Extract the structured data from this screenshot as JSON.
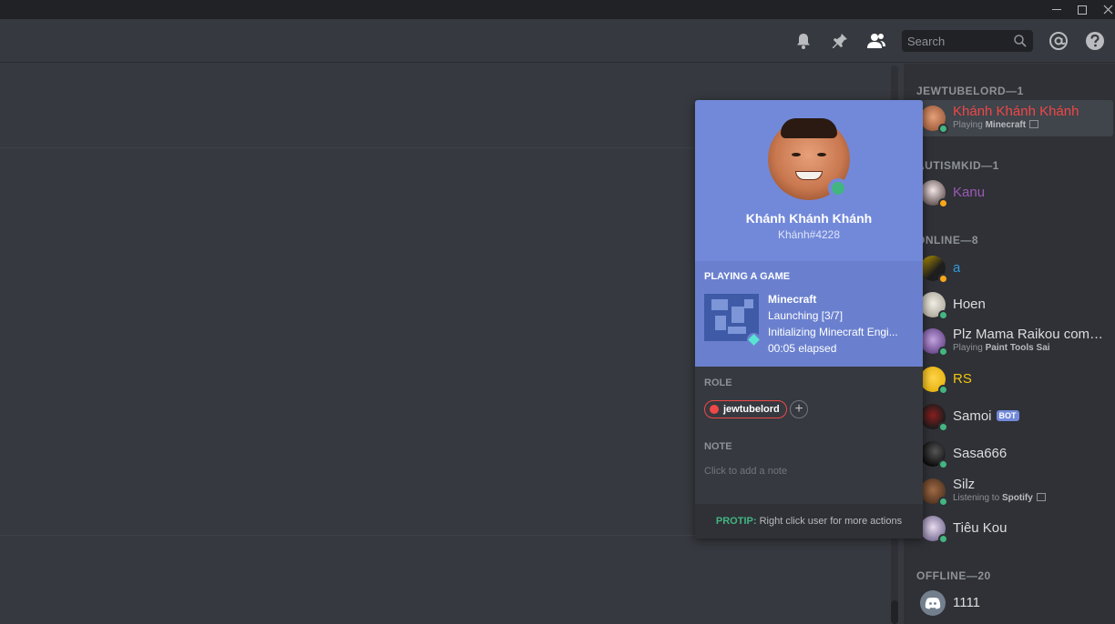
{
  "titlebar": {
    "controls": [
      "minimize",
      "maximize",
      "close"
    ]
  },
  "header": {
    "icons": [
      "bell-icon",
      "pin-icon",
      "members-icon",
      "at-mention-icon",
      "help-icon"
    ],
    "search_placeholder": "Search"
  },
  "popout": {
    "display_name": "Khánh Khánh Khánh",
    "tag": "Khánh#4228",
    "status": "online",
    "activity": {
      "heading": "PLAYING A GAME",
      "game": "Minecraft",
      "details": "Launching [3/7]",
      "state": "Initializing Minecraft Engi...",
      "elapsed": "00:05 elapsed"
    },
    "role_heading": "ROLE",
    "role": {
      "name": "jewtubelord",
      "color": "#f04747"
    },
    "note_heading": "NOTE",
    "note_placeholder": "Click to add a note",
    "protip_label": "PROTIP:",
    "protip_text": "Right click user for more actions"
  },
  "members": {
    "groups": [
      {
        "title": "JEWTUBELORD—1",
        "members": [
          {
            "name": "Khánh Khánh Khánh",
            "color": "#f04747",
            "status": "online",
            "sub_prefix": "Playing",
            "sub_bold": "Minecraft",
            "rich": true,
            "active": true
          }
        ]
      },
      {
        "title": "AUTISMKID—1",
        "members": [
          {
            "name": "Kanu",
            "color": "#9b59b6",
            "status": "idle"
          }
        ]
      },
      {
        "title": "ONLINE—8",
        "members": [
          {
            "name": "a",
            "color": "#3498db",
            "status": "idle"
          },
          {
            "name": "Hoen",
            "color": "#dcddde",
            "status": "online"
          },
          {
            "name": "Plz Mama Raikou come...",
            "color": "#dcddde",
            "status": "online",
            "sub_prefix": "Playing",
            "sub_bold": "Paint Tools Sai"
          },
          {
            "name": "RS",
            "color": "#f1c40f",
            "status": "online"
          },
          {
            "name": "Samoi",
            "color": "#dcddde",
            "status": "online",
            "bot": "BOT"
          },
          {
            "name": "Sasa666",
            "color": "#dcddde",
            "status": "online"
          },
          {
            "name": "Silz",
            "color": "#dcddde",
            "status": "online",
            "sub_prefix": "Listening to",
            "sub_bold": "Spotify",
            "rich": true
          },
          {
            "name": "Tiêu Kou",
            "color": "#dcddde",
            "status": "online"
          }
        ]
      },
      {
        "title": "OFFLINE—20",
        "members": [
          {
            "name": "1111",
            "color": "#dcddde",
            "status": "offline"
          }
        ]
      }
    ]
  },
  "colors": {
    "blurple": "#7289da",
    "online": "#43b581",
    "idle": "#faa61a",
    "danger": "#f04747"
  }
}
